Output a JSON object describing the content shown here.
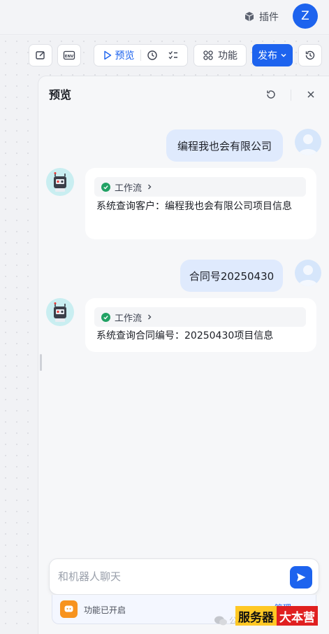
{
  "header": {
    "plugin_label": "插件",
    "user_initial": "Z"
  },
  "toolbar": {
    "preview_label": "预览",
    "features_label": "功能",
    "publish_label": "发布"
  },
  "preview_panel": {
    "title": "预览"
  },
  "chat": {
    "messages": [
      {
        "role": "user",
        "text": "编程我也会有限公司"
      },
      {
        "role": "bot",
        "workflow_label": "工作流",
        "text": "系统查询客户：编程我也会有限公司项目信息"
      },
      {
        "role": "user",
        "text": "合同号20250430"
      },
      {
        "role": "bot",
        "workflow_label": "工作流",
        "text": "系统查询合同编号：20250430项目信息"
      }
    ]
  },
  "composer": {
    "placeholder": "和机器人聊天",
    "value": ""
  },
  "feature_bar": {
    "status": "功能已开启",
    "manage_label": "管理"
  },
  "watermark": {
    "text": "公",
    "badge_left": "服务器",
    "badge_right": "大本营"
  }
}
